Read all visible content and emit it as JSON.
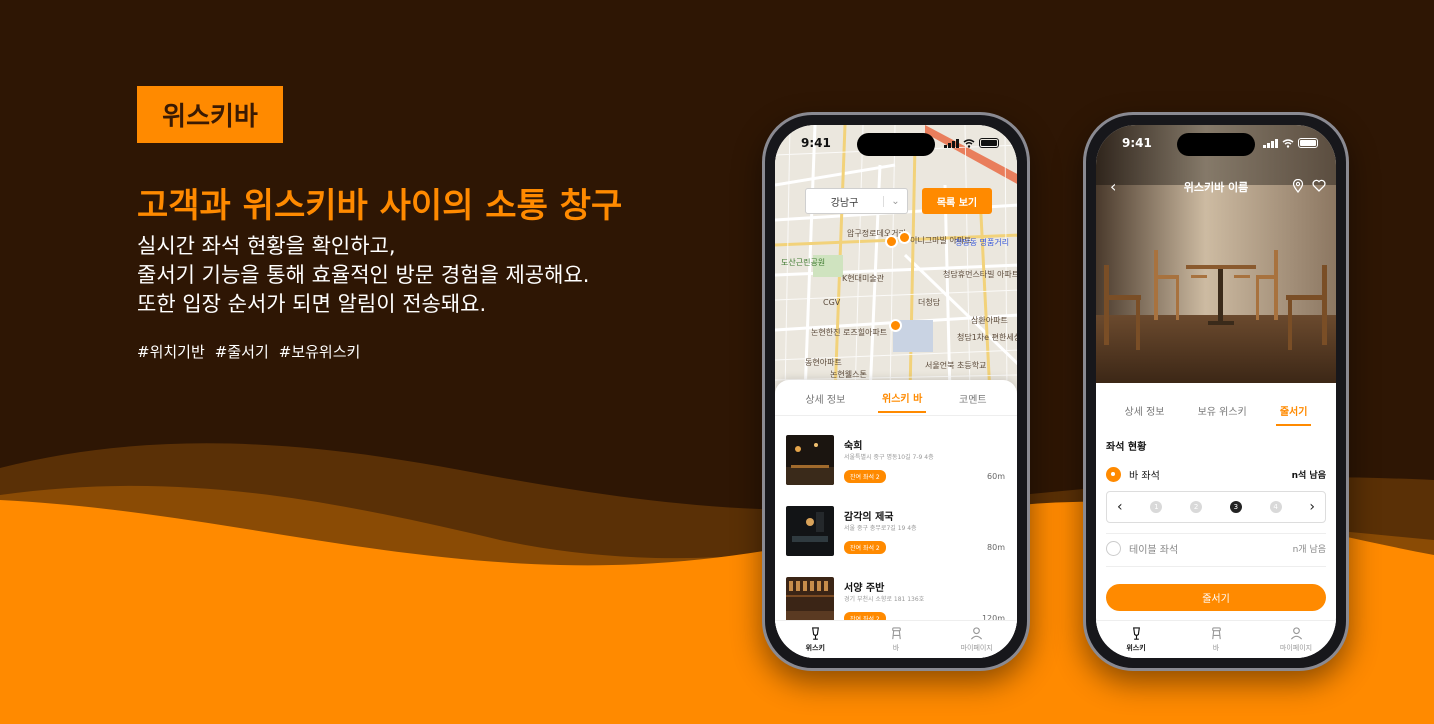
{
  "promo": {
    "badge": "위스키바",
    "headline": "고객과 위스키바 사이의 소통 창구",
    "desc_lines": [
      "실시간 좌석 현황을 확인하고,",
      "줄서기 기능을 통해 효율적인 방문 경험을 제공해요.",
      "또한 입장 순서가 되면 알림이 전송돼요."
    ],
    "tags": [
      "#위치기반",
      "#줄서기",
      "#보유위스키"
    ],
    "accent_color": "#ff8a00",
    "background_color": "#2e1604"
  },
  "phone1": {
    "time": "9:41",
    "district_select": {
      "value": "강남구"
    },
    "list_button": "목록 보기",
    "map_labels": [
      "압구정로데오거리",
      "이니그마빌 아파트",
      "청담동 명품거리",
      "K현대미술관",
      "도산근린공원",
      "CGV",
      "더청담",
      "청담휴먼스타빌 아파트",
      "삼환아파트",
      "논현한진 로즈힐아파트",
      "청담1차e 편한세상아파트",
      "동현아파트",
      "서울언북 초등학교",
      "논현웰스톤"
    ],
    "tabs": [
      "상세 정보",
      "위스키 바",
      "코멘트"
    ],
    "bars": [
      {
        "name": "숙희",
        "address": "서울특별시 중구 명동10길 7-9 4층",
        "chip": "잔여 좌석 2",
        "distance": "60m"
      },
      {
        "name": "감각의 제국",
        "address": "서울 중구 충무로7길 19 4층",
        "chip": "잔여 좌석 2",
        "distance": "80m"
      },
      {
        "name": "서양 주반",
        "address": "경기 부천시 소향로 181 136호",
        "chip": "잔여 좌석 2",
        "distance": "120m"
      }
    ],
    "nav": [
      "위스키",
      "바",
      "마이페이지"
    ]
  },
  "phone2": {
    "time": "9:41",
    "title": "위스키바 이름",
    "tabs": [
      "상세 정보",
      "보유 위스키",
      "줄서기"
    ],
    "section_title": "좌석 현황",
    "seat_bar": {
      "label": "바 좌석",
      "remain": "n석 남음"
    },
    "seat_table": {
      "label": "테이블 좌석",
      "remain": "n개 남음"
    },
    "stepper": [
      "1",
      "2",
      "3",
      "4"
    ],
    "queue_button": "줄서기",
    "nav": [
      "위스키",
      "바",
      "마이페이지"
    ]
  }
}
